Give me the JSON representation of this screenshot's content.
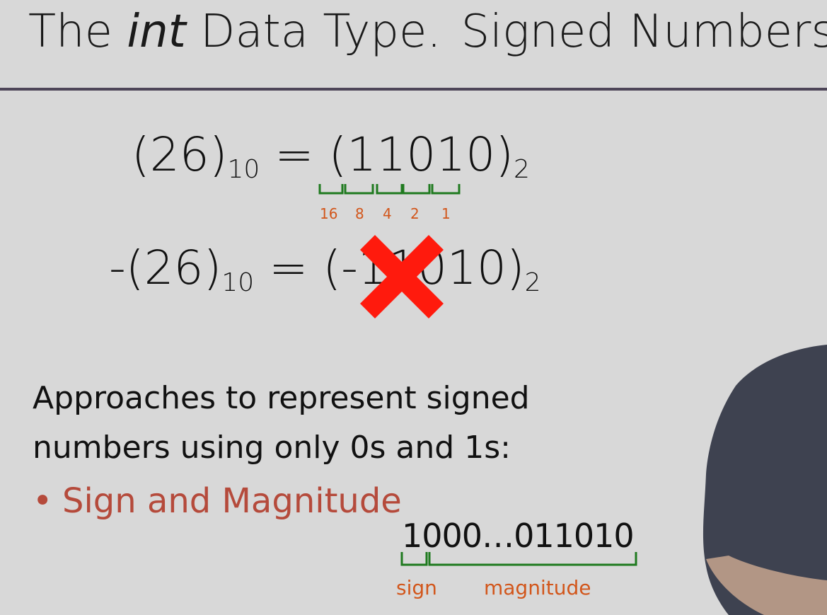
{
  "slide": {
    "title_part1": "The ",
    "title_italic": "int",
    "title_part2": " Data Type.",
    "title_part3": "Signed Numbers"
  },
  "equation1": {
    "lhs": "(26)",
    "lhs_base": "10",
    "eq": " = ",
    "rhs": "(11010)",
    "rhs_base": "2",
    "weights": [
      "16",
      "8",
      "4",
      "2",
      "1"
    ]
  },
  "equation2": {
    "lhs": "-(26)",
    "lhs_base": "10",
    "eq": " = ",
    "rhs": "(-11010)",
    "rhs_base": "2"
  },
  "body": {
    "approaches_line1": "Approaches to represent signed",
    "approaches_line2": "numbers using only 0s and 1s:",
    "bullet": "Sign and Magnitude",
    "bit_pattern": "1000…011010",
    "sign_label": "sign",
    "magnitude_label": "magnitude"
  },
  "colors": {
    "background": "#d8d8d8",
    "rule": "#4d4558",
    "bracket_green": "#1f7a1f",
    "label_orange": "#d2561b",
    "bullet_red": "#b54a3b",
    "cross_red": "#ff1a0d"
  },
  "icons": {
    "cross": "red-x-cross-icon"
  }
}
